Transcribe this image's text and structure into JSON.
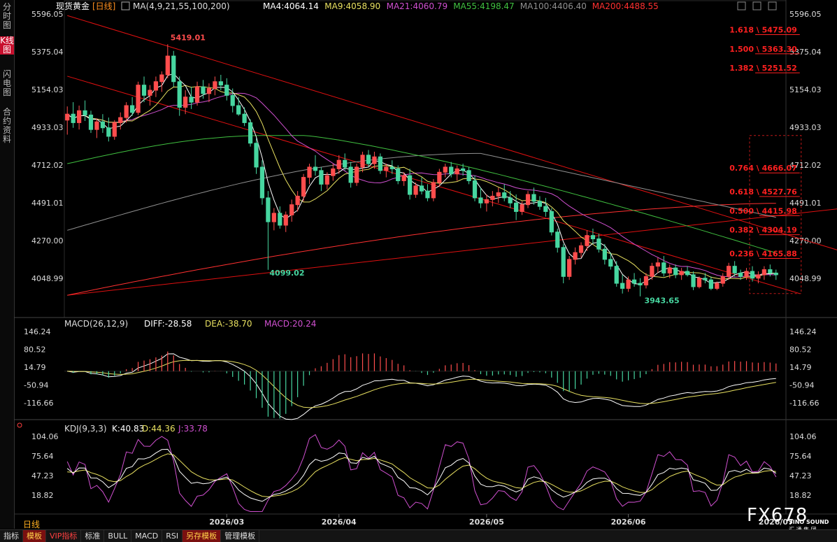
{
  "sidebar": {
    "items": [
      "分时图",
      "K线图",
      "闪电图",
      "合约资料"
    ]
  },
  "toolbar": {
    "items": [
      "指标",
      "模板",
      "VIP指标",
      "标准",
      "BULL",
      "MACD",
      "RSI",
      "另存模板",
      "管理模板"
    ]
  },
  "period_tab": "日线",
  "watermark": {
    "brand": "FX678",
    "sub1": "SINO SOUND",
    "sub2": "汇 通 集 团"
  },
  "colors": {
    "up": "#ff4d4d",
    "down": "#47d6a0",
    "fib": "#ff2020",
    "ma4": "#ffffff",
    "ma9": "#e8e060",
    "ma21": "#d050d0",
    "ma55": "#40c040",
    "ma100": "#909090",
    "ma200": "#ff3030"
  },
  "chart_data": [
    {
      "type": "candlestick",
      "title": "现货黄金",
      "period": "日线",
      "indicator_label": "MA(4,9,21,55,100,200)",
      "ma_values": {
        "MA4": "4064.14",
        "MA9": "4058.90",
        "MA21": "4060.79",
        "MA55": "4198.47",
        "MA100": "4406.40",
        "MA200": "4488.55"
      },
      "ylim": [
        3943.65,
        5596.05
      ],
      "y_ticks": [
        "5596.05",
        "5375.04",
        "5154.03",
        "4933.03",
        "4712.02",
        "4491.01",
        "4270.00",
        "4048.99"
      ],
      "x_ticks": [
        "2026/03",
        "2026/04",
        "2026/05",
        "2026/06",
        "2026/07"
      ],
      "annotations": {
        "high": "5419.01",
        "low1": "4099.02",
        "low2": "3943.65"
      },
      "fib_levels": [
        {
          "label": "1.618 \\ 5475.09",
          "value": 5475.09
        },
        {
          "label": "1.500 \\ 5363.30",
          "value": 5363.3
        },
        {
          "label": "1.382 \\ 5251.52",
          "value": 5251.52
        },
        {
          "label": "0.764 \\ 4666.07",
          "value": 4666.07
        },
        {
          "label": "0.618 \\ 4527.76",
          "value": 4527.76
        },
        {
          "label": "0.500 \\ 4415.98",
          "value": 4415.98
        },
        {
          "label": "0.382 \\ 4304.19",
          "value": 4304.19
        },
        {
          "label": "0.236 \\ 4165.88",
          "value": 4165.88
        }
      ],
      "fib_box": {
        "top": 4885,
        "bottom": 3960
      },
      "trend_lines": [
        {
          "from": [
            0,
            5587
          ],
          "to": [
            147,
            4040
          ]
        },
        {
          "from": [
            0,
            5232
          ],
          "to": [
            124,
            3960
          ]
        },
        {
          "from": [
            0,
            3950
          ],
          "to": [
            147,
            4520
          ]
        }
      ],
      "ohlc": [
        {
          "o": 4975,
          "h": 5055,
          "l": 4890,
          "c": 5010
        },
        {
          "o": 5010,
          "h": 5080,
          "l": 4930,
          "c": 4960
        },
        {
          "o": 4960,
          "h": 5060,
          "l": 4920,
          "c": 5030
        },
        {
          "o": 5030,
          "h": 5090,
          "l": 4970,
          "c": 5005
        },
        {
          "o": 5005,
          "h": 5030,
          "l": 4900,
          "c": 4920
        },
        {
          "o": 4920,
          "h": 4985,
          "l": 4870,
          "c": 4965
        },
        {
          "o": 4965,
          "h": 5010,
          "l": 4900,
          "c": 4930
        },
        {
          "o": 4930,
          "h": 4990,
          "l": 4850,
          "c": 4880
        },
        {
          "o": 4880,
          "h": 4975,
          "l": 4860,
          "c": 4960
        },
        {
          "o": 4960,
          "h": 5020,
          "l": 4920,
          "c": 4990
        },
        {
          "o": 4990,
          "h": 5080,
          "l": 4960,
          "c": 5060
        },
        {
          "o": 5060,
          "h": 5110,
          "l": 5000,
          "c": 5020
        },
        {
          "o": 5020,
          "h": 5200,
          "l": 5005,
          "c": 5180
        },
        {
          "o": 5180,
          "h": 5230,
          "l": 5080,
          "c": 5120
        },
        {
          "o": 5120,
          "h": 5180,
          "l": 5060,
          "c": 5150
        },
        {
          "o": 5150,
          "h": 5230,
          "l": 5110,
          "c": 5200
        },
        {
          "o": 5200,
          "h": 5260,
          "l": 5140,
          "c": 5240
        },
        {
          "o": 5240,
          "h": 5419.01,
          "l": 5220,
          "c": 5350
        },
        {
          "o": 5350,
          "h": 5380,
          "l": 5170,
          "c": 5200
        },
        {
          "o": 5200,
          "h": 5230,
          "l": 5000,
          "c": 5050
        },
        {
          "o": 5050,
          "h": 5150,
          "l": 5010,
          "c": 5110
        },
        {
          "o": 5110,
          "h": 5170,
          "l": 5040,
          "c": 5080
        },
        {
          "o": 5080,
          "h": 5200,
          "l": 5060,
          "c": 5170
        },
        {
          "o": 5170,
          "h": 5210,
          "l": 5100,
          "c": 5130
        },
        {
          "o": 5130,
          "h": 5190,
          "l": 5080,
          "c": 5160
        },
        {
          "o": 5160,
          "h": 5230,
          "l": 5120,
          "c": 5200
        },
        {
          "o": 5200,
          "h": 5240,
          "l": 5150,
          "c": 5180
        },
        {
          "o": 5180,
          "h": 5220,
          "l": 5090,
          "c": 5120
        },
        {
          "o": 5120,
          "h": 5160,
          "l": 5020,
          "c": 5060
        },
        {
          "o": 5060,
          "h": 5110,
          "l": 5000,
          "c": 5010
        },
        {
          "o": 5010,
          "h": 5050,
          "l": 4940,
          "c": 4960
        },
        {
          "o": 4960,
          "h": 4980,
          "l": 4820,
          "c": 4840
        },
        {
          "o": 4840,
          "h": 4870,
          "l": 4660,
          "c": 4700
        },
        {
          "o": 4700,
          "h": 4740,
          "l": 4480,
          "c": 4520
        },
        {
          "o": 4520,
          "h": 4560,
          "l": 4099.02,
          "c": 4380
        },
        {
          "o": 4380,
          "h": 4460,
          "l": 4330,
          "c": 4430
        },
        {
          "o": 4430,
          "h": 4470,
          "l": 4340,
          "c": 4360
        },
        {
          "o": 4360,
          "h": 4440,
          "l": 4320,
          "c": 4420
        },
        {
          "o": 4420,
          "h": 4510,
          "l": 4380,
          "c": 4480
        },
        {
          "o": 4480,
          "h": 4560,
          "l": 4440,
          "c": 4530
        },
        {
          "o": 4530,
          "h": 4660,
          "l": 4500,
          "c": 4640
        },
        {
          "o": 4640,
          "h": 4720,
          "l": 4600,
          "c": 4700
        },
        {
          "o": 4700,
          "h": 4770,
          "l": 4650,
          "c": 4680
        },
        {
          "o": 4680,
          "h": 4700,
          "l": 4560,
          "c": 4600
        },
        {
          "o": 4600,
          "h": 4670,
          "l": 4570,
          "c": 4650
        },
        {
          "o": 4650,
          "h": 4720,
          "l": 4620,
          "c": 4690
        },
        {
          "o": 4690,
          "h": 4770,
          "l": 4660,
          "c": 4740
        },
        {
          "o": 4740,
          "h": 4780,
          "l": 4680,
          "c": 4700
        },
        {
          "o": 4700,
          "h": 4730,
          "l": 4580,
          "c": 4610
        },
        {
          "o": 4610,
          "h": 4720,
          "l": 4590,
          "c": 4700
        },
        {
          "o": 4700,
          "h": 4790,
          "l": 4670,
          "c": 4770
        },
        {
          "o": 4770,
          "h": 4800,
          "l": 4700,
          "c": 4720
        },
        {
          "o": 4720,
          "h": 4790,
          "l": 4690,
          "c": 4760
        },
        {
          "o": 4760,
          "h": 4780,
          "l": 4660,
          "c": 4680
        },
        {
          "o": 4680,
          "h": 4720,
          "l": 4640,
          "c": 4700
        },
        {
          "o": 4700,
          "h": 4740,
          "l": 4660,
          "c": 4690
        },
        {
          "o": 4690,
          "h": 4710,
          "l": 4600,
          "c": 4620
        },
        {
          "o": 4620,
          "h": 4670,
          "l": 4590,
          "c": 4650
        },
        {
          "o": 4650,
          "h": 4690,
          "l": 4510,
          "c": 4540
        },
        {
          "o": 4540,
          "h": 4610,
          "l": 4520,
          "c": 4590
        },
        {
          "o": 4590,
          "h": 4640,
          "l": 4540,
          "c": 4560
        },
        {
          "o": 4560,
          "h": 4600,
          "l": 4500,
          "c": 4520
        },
        {
          "o": 4520,
          "h": 4630,
          "l": 4500,
          "c": 4610
        },
        {
          "o": 4610,
          "h": 4690,
          "l": 4590,
          "c": 4670
        },
        {
          "o": 4670,
          "h": 4720,
          "l": 4640,
          "c": 4700
        },
        {
          "o": 4700,
          "h": 4730,
          "l": 4640,
          "c": 4660
        },
        {
          "o": 4660,
          "h": 4710,
          "l": 4620,
          "c": 4690
        },
        {
          "o": 4690,
          "h": 4720,
          "l": 4650,
          "c": 4680
        },
        {
          "o": 4680,
          "h": 4700,
          "l": 4600,
          "c": 4620
        },
        {
          "o": 4620,
          "h": 4650,
          "l": 4500,
          "c": 4520
        },
        {
          "o": 4520,
          "h": 4580,
          "l": 4460,
          "c": 4490
        },
        {
          "o": 4490,
          "h": 4540,
          "l": 4440,
          "c": 4510
        },
        {
          "o": 4510,
          "h": 4560,
          "l": 4470,
          "c": 4530
        },
        {
          "o": 4530,
          "h": 4580,
          "l": 4490,
          "c": 4550
        },
        {
          "o": 4550,
          "h": 4600,
          "l": 4500,
          "c": 4520
        },
        {
          "o": 4520,
          "h": 4560,
          "l": 4460,
          "c": 4490
        },
        {
          "o": 4490,
          "h": 4540,
          "l": 4390,
          "c": 4440
        },
        {
          "o": 4440,
          "h": 4500,
          "l": 4420,
          "c": 4480
        },
        {
          "o": 4480,
          "h": 4560,
          "l": 4460,
          "c": 4540
        },
        {
          "o": 4540,
          "h": 4580,
          "l": 4480,
          "c": 4500
        },
        {
          "o": 4500,
          "h": 4530,
          "l": 4450,
          "c": 4470
        },
        {
          "o": 4470,
          "h": 4520,
          "l": 4410,
          "c": 4440
        },
        {
          "o": 4440,
          "h": 4460,
          "l": 4300,
          "c": 4320
        },
        {
          "o": 4320,
          "h": 4340,
          "l": 4200,
          "c": 4230
        },
        {
          "o": 4230,
          "h": 4250,
          "l": 4020,
          "c": 4060
        },
        {
          "o": 4060,
          "h": 4180,
          "l": 4040,
          "c": 4160
        },
        {
          "o": 4160,
          "h": 4230,
          "l": 4130,
          "c": 4200
        },
        {
          "o": 4200,
          "h": 4260,
          "l": 4170,
          "c": 4240
        },
        {
          "o": 4240,
          "h": 4330,
          "l": 4210,
          "c": 4300
        },
        {
          "o": 4300,
          "h": 4340,
          "l": 4250,
          "c": 4280
        },
        {
          "o": 4280,
          "h": 4310,
          "l": 4200,
          "c": 4220
        },
        {
          "o": 4220,
          "h": 4250,
          "l": 4130,
          "c": 4160
        },
        {
          "o": 4160,
          "h": 4200,
          "l": 4100,
          "c": 4120
        },
        {
          "o": 4120,
          "h": 4150,
          "l": 4000,
          "c": 4020
        },
        {
          "o": 4020,
          "h": 4070,
          "l": 3960,
          "c": 3990
        },
        {
          "o": 3990,
          "h": 4060,
          "l": 3970,
          "c": 4040
        },
        {
          "o": 4040,
          "h": 4080,
          "l": 4000,
          "c": 4020
        },
        {
          "o": 4020,
          "h": 4050,
          "l": 3943.65,
          "c": 4010
        },
        {
          "o": 4010,
          "h": 4080,
          "l": 3990,
          "c": 4060
        },
        {
          "o": 4060,
          "h": 4140,
          "l": 4040,
          "c": 4120
        },
        {
          "o": 4120,
          "h": 4170,
          "l": 4080,
          "c": 4140
        },
        {
          "o": 4140,
          "h": 4180,
          "l": 4060,
          "c": 4080
        },
        {
          "o": 4080,
          "h": 4130,
          "l": 4050,
          "c": 4110
        },
        {
          "o": 4110,
          "h": 4130,
          "l": 4050,
          "c": 4070
        },
        {
          "o": 4070,
          "h": 4110,
          "l": 4040,
          "c": 4090
        },
        {
          "o": 4090,
          "h": 4120,
          "l": 4060,
          "c": 4070
        },
        {
          "o": 4070,
          "h": 4090,
          "l": 3980,
          "c": 4000
        },
        {
          "o": 4000,
          "h": 4060,
          "l": 3990,
          "c": 4050
        },
        {
          "o": 4050,
          "h": 4080,
          "l": 4020,
          "c": 4040
        },
        {
          "o": 4040,
          "h": 4060,
          "l": 3980,
          "c": 3990
        },
        {
          "o": 3990,
          "h": 4030,
          "l": 3980,
          "c": 4020
        },
        {
          "o": 4020,
          "h": 4080,
          "l": 4000,
          "c": 4060
        },
        {
          "o": 4060,
          "h": 4140,
          "l": 4040,
          "c": 4120
        },
        {
          "o": 4120,
          "h": 4150,
          "l": 4060,
          "c": 4080
        },
        {
          "o": 4080,
          "h": 4100,
          "l": 4040,
          "c": 4060
        },
        {
          "o": 4060,
          "h": 4110,
          "l": 4040,
          "c": 4090
        },
        {
          "o": 4090,
          "h": 4120,
          "l": 4030,
          "c": 4050
        },
        {
          "o": 4050,
          "h": 4090,
          "l": 4020,
          "c": 4070
        },
        {
          "o": 4070,
          "h": 4120,
          "l": 4040,
          "c": 4100
        },
        {
          "o": 4100,
          "h": 4130,
          "l": 4060,
          "c": 4080
        },
        {
          "o": 4080,
          "h": 4100,
          "l": 4040,
          "c": 4070
        }
      ]
    },
    {
      "type": "macd",
      "label": "MACD(26,12,9)",
      "values": {
        "DIFF": "DIFF:-28.58",
        "DEA": "DEA:-38.70",
        "MACD": "MACD:20.24"
      },
      "ylim": [
        -150,
        160
      ],
      "y_ticks": [
        "146.24",
        "80.52",
        "14.79",
        "-50.94",
        "-116.66"
      ]
    },
    {
      "type": "kdj",
      "label": "KDJ(9,3,3)",
      "values": {
        "K": "K:40.83",
        "D": "D:44.36",
        "J": "J:33.78"
      },
      "ylim": [
        5,
        108
      ],
      "y_ticks": [
        "104.06",
        "75.64",
        "47.23",
        "18.82"
      ]
    }
  ]
}
